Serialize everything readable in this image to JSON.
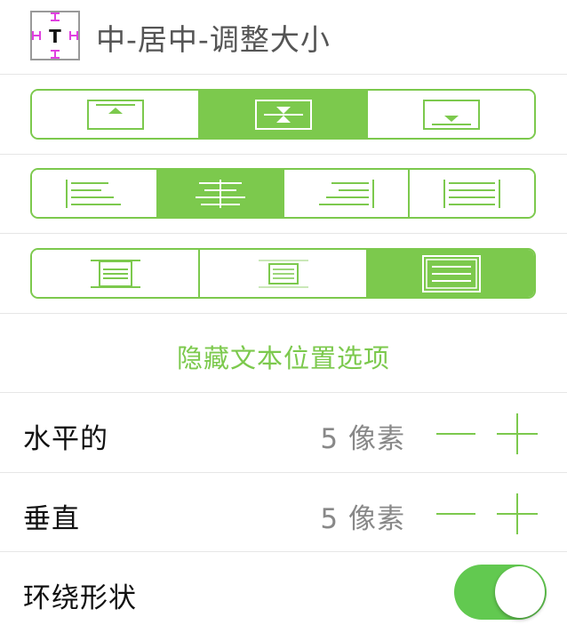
{
  "title": {
    "text": "中-居中-调整大小",
    "icon": "text-position-icon",
    "icon_glyph": "T"
  },
  "vertical_position": {
    "options": [
      "top-align-icon",
      "middle-align-icon",
      "bottom-align-icon"
    ],
    "selected_index": 1
  },
  "text_alignment": {
    "options": [
      "align-left-icon",
      "align-center-icon",
      "align-right-icon",
      "align-justify-icon"
    ],
    "selected_index": 1
  },
  "fit_mode": {
    "options": [
      "fit-expand-icon",
      "fit-shrink-icon",
      "fit-frame-icon"
    ],
    "selected_index": 2
  },
  "hide_text_position": {
    "label": "隐藏文本位置选项"
  },
  "horizontal_padding": {
    "label": "水平的",
    "value": "5 像素"
  },
  "vertical_padding": {
    "label": "垂直",
    "value": "5 像素"
  },
  "wrap_shape": {
    "label": "环绕形状",
    "on": true
  },
  "colors": {
    "accent": "#7cc94d",
    "toggle_on": "#62c950",
    "selector_handles": "#e040e0",
    "secondary_text": "#888888"
  }
}
